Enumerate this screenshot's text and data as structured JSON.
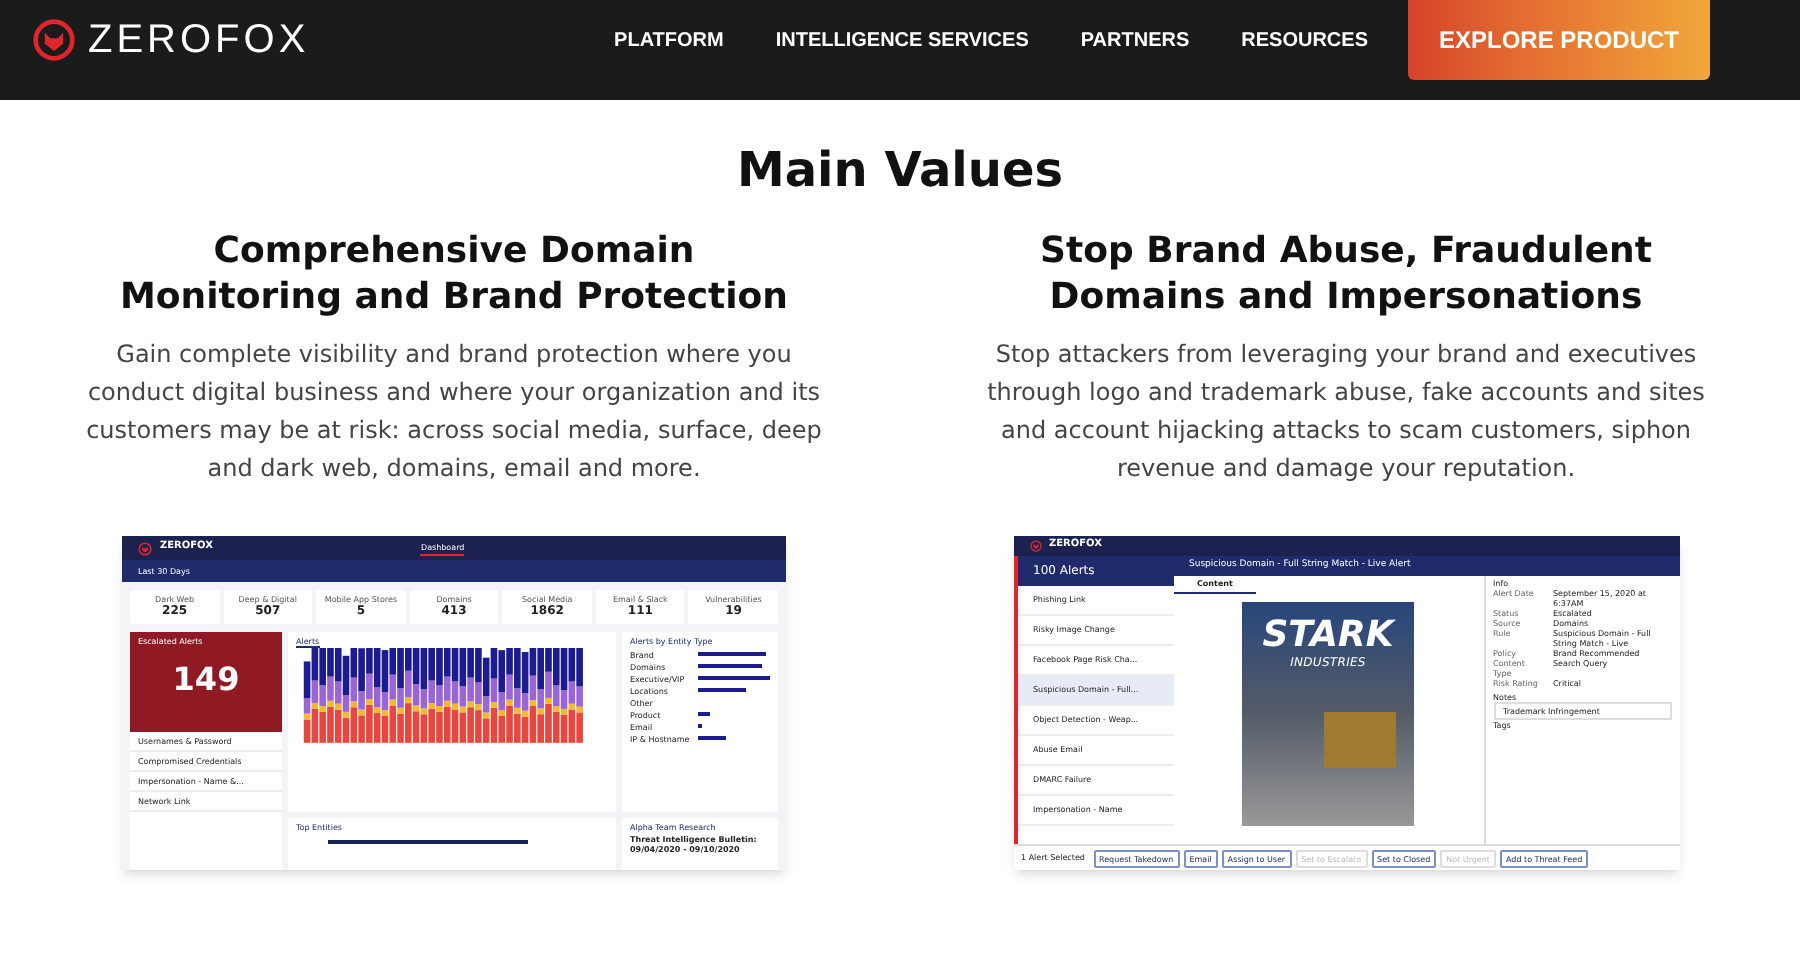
{
  "header": {
    "logo": "ZEROFOX",
    "nav": [
      "PLATFORM",
      "INTELLIGENCE SERVICES",
      "PARTNERS",
      "RESOURCES"
    ],
    "cta": "EXPLORE PRODUCT"
  },
  "title": "Main Values",
  "columns": [
    {
      "heading": "Comprehensive Domain Monitoring and Brand Protection",
      "body": "Gain complete visibility and brand protection where you conduct digital business and where your organization and its customers may be at risk: across social media, surface, deep and dark web, domains, email and more.",
      "screenshot": {
        "kind": "dashboard",
        "logo": "ZEROFOX",
        "tab": "Dashboard",
        "range": "Last 30 Days",
        "stats": [
          {
            "label": "Dark Web",
            "value": "225"
          },
          {
            "label": "Deep & Digital",
            "value": "507"
          },
          {
            "label": "Mobile App Stores",
            "value": "5"
          },
          {
            "label": "Domains",
            "value": "413"
          },
          {
            "label": "Social Media",
            "value": "1862"
          },
          {
            "label": "Email & Slack",
            "value": "111"
          },
          {
            "label": "Vulnerabilities",
            "value": "19"
          }
        ],
        "escalated_label": "Escalated Alerts",
        "escalated_count": "149",
        "alerts": [
          "Usernames & Password",
          "Compromised Credentials",
          "Impersonation - Name &...",
          "Network Link"
        ],
        "chart_tab": "Alerts",
        "entity_title": "Alerts by Entity Type",
        "entities": [
          "Brand",
          "Domains",
          "Executive/VIP",
          "Locations",
          "Other",
          "Product",
          "Email",
          "IP & Hostname"
        ],
        "top_title": "Top Entities",
        "research_title": "Alpha Team Research",
        "bulletin": "Threat Intelligence Bulletin: 09/04/2020 - 09/10/2020"
      }
    },
    {
      "heading": "Stop Brand Abuse, Fraudulent Domains and Impersonations",
      "body": "Stop attackers from leveraging your brand and executives through logo and trademark abuse, fake accounts and sites and account hijacking attacks to scam customers, siphon revenue and damage your reputation.",
      "screenshot": {
        "kind": "alert",
        "logo": "ZEROFOX",
        "count": "100 Alerts",
        "alert_title": "Suspicious Domain - Full String Match - Live Alert",
        "list": [
          {
            "title": "Phishing Link",
            "selected": false
          },
          {
            "title": "Risky Image Change",
            "selected": false
          },
          {
            "title": "Facebook Page Risk Cha...",
            "selected": false
          },
          {
            "title": "Suspicious Domain - Full...",
            "selected": true
          },
          {
            "title": "Object Detection - Weap...",
            "selected": false
          },
          {
            "title": "Abuse Email",
            "selected": false
          },
          {
            "title": "DMARC Failure",
            "selected": false
          },
          {
            "title": "Impersonation - Name",
            "selected": false
          }
        ],
        "content_tab": "Content",
        "site_name": "STARK",
        "site_sub": "INDUSTRIES",
        "info_title": "Info",
        "fields": [
          {
            "label": "Alert Date",
            "value": "September 15, 2020 at 6:37AM"
          },
          {
            "label": "Status",
            "value": "Escalated"
          },
          {
            "label": "Source",
            "value": "Domains"
          },
          {
            "label": "Rule",
            "value": "Suspicious Domain - Full String Match - Live"
          },
          {
            "label": "Policy",
            "value": "Brand Recommended"
          },
          {
            "label": "Content Type",
            "value": "Search Query"
          },
          {
            "label": "Risk Rating",
            "value": "Critical"
          }
        ],
        "notes_label": "Notes",
        "note": "Trademark Infringement",
        "tags_label": "Tags",
        "selection": "1 Alert Selected",
        "actions": [
          {
            "label": "Request Takedown",
            "disabled": false
          },
          {
            "label": "Email",
            "disabled": false
          },
          {
            "label": "Assign to User",
            "disabled": false
          },
          {
            "label": "Set to Escalate",
            "disabled": true
          },
          {
            "label": "Set to Closed",
            "disabled": false
          },
          {
            "label": "Not Urgent",
            "disabled": true
          },
          {
            "label": "Add to Threat Feed",
            "disabled": false
          }
        ]
      }
    }
  ]
}
